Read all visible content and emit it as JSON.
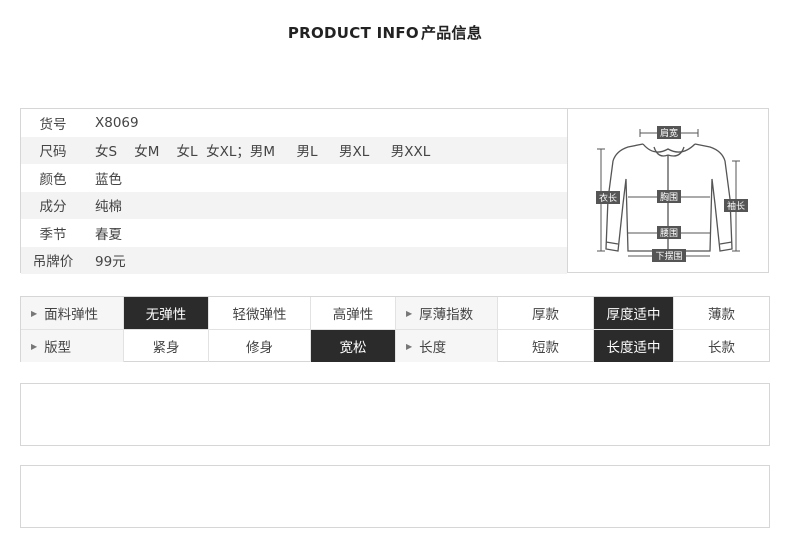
{
  "title": {
    "en": "PRODUCT  INFO",
    "zh": "产品信息"
  },
  "info": {
    "rows": [
      {
        "label": "货号",
        "value": "X8069"
      },
      {
        "label": "尺码",
        "value": "女S    女M    女L  女XL；男M     男L     男XL     男XXL"
      },
      {
        "label": "颜色",
        "value": "蓝色"
      },
      {
        "label": "成分",
        "value": "纯棉"
      },
      {
        "label": "季节",
        "value": "春夏"
      },
      {
        "label": "吊牌价",
        "value": "99元"
      }
    ]
  },
  "diagram": {
    "labels": {
      "shoulder": "肩宽",
      "length": "衣长",
      "chest": "胸围",
      "sleeve": "袖长",
      "waist": "腰围",
      "hem": "下摆围"
    }
  },
  "attributes": {
    "rows": [
      {
        "cells": [
          {
            "text": "面料弹性",
            "head": true
          },
          {
            "text": "无弹性",
            "selected": true
          },
          {
            "text": "轻微弹性"
          },
          {
            "text": "高弹性"
          },
          {
            "text": "厚薄指数",
            "head": true
          },
          {
            "text": "厚款"
          },
          {
            "text": "厚度适中",
            "selected": true
          },
          {
            "text": "薄款"
          }
        ]
      },
      {
        "cells": [
          {
            "text": "版型",
            "head": true
          },
          {
            "text": "紧身"
          },
          {
            "text": "修身"
          },
          {
            "text": "宽松",
            "selected": true
          },
          {
            "text": "长度",
            "head": true
          },
          {
            "text": "短款"
          },
          {
            "text": "长度适中",
            "selected": true
          },
          {
            "text": "长款"
          }
        ]
      }
    ]
  },
  "colors": {
    "selected": "#2b2b2b",
    "header_bg": "#f6f6f6",
    "alt_row": "#f3f3f3",
    "border": "#d6d6d6"
  }
}
